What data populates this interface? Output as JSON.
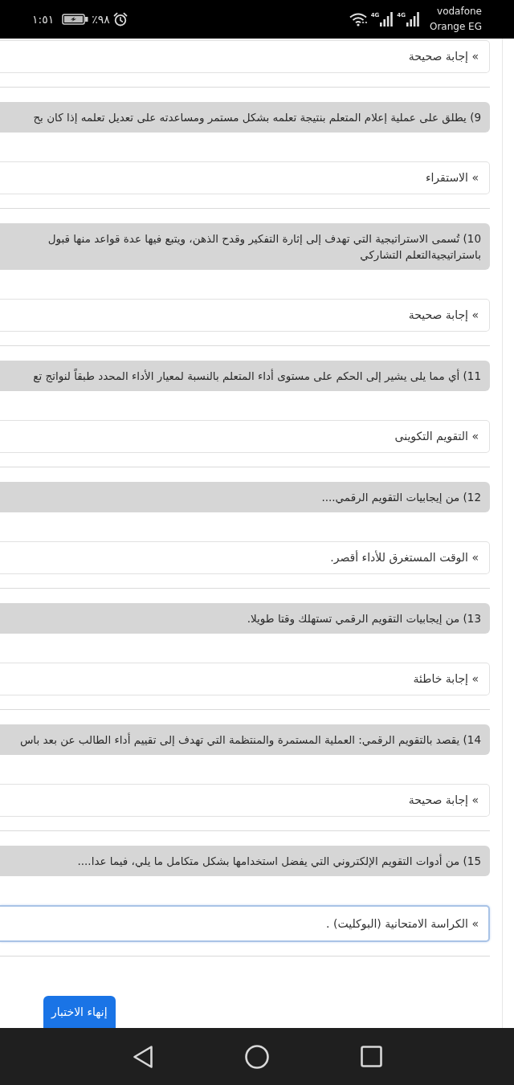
{
  "status_bar": {
    "time": "١:٥١",
    "battery_percent": "٪٩٨",
    "network_types": [
      "4G",
      "4G"
    ],
    "carriers": [
      "vodafone",
      "Orange EG"
    ]
  },
  "quiz": {
    "previous_answer": {
      "text": "» إجابة صحيحة",
      "focused": false
    },
    "questions": [
      {
        "prompt": "9) يطلق على عملية إعلام المتعلم بنتيجة تعلمه بشكل مستمر ومساعدته على تعديل تعلمه إذا كان بح",
        "answer": "» الاستقراء",
        "focused": false
      },
      {
        "prompt": "10) تُسمى الاستراتيجية التي تهدف إلى إثارة التفكير وقدح الذهن، ويتبع فيها عدة قواعد منها قبول باستراتيجيةالتعلم التشاركي",
        "answer": "» إجابة صحيحة",
        "focused": false
      },
      {
        "prompt": "11) أي مما يلى يشير إلى الحكم على مستوى أداء المتعلم بالنسبة لمعيار الأداء المحدد طبقاً لنواتج تع",
        "answer": "» التقويم التكوينى",
        "focused": false
      },
      {
        "prompt": "12) من إيجابيات التقويم الرقمي....",
        "answer": "» الوقت المستغرق للأداء أقصر.",
        "focused": false
      },
      {
        "prompt": "13) من إيجابيات التقويم الرقمي تستهلك وقتا طويلا.",
        "answer": "» إجابة خاطئة",
        "focused": false
      },
      {
        "prompt": "14) يقصد بالتقويم الرقمي: العملية المستمرة والمنتظمة التي تهدف إلى تقييم أداء الطالب عن بعد باس",
        "answer": "» إجابة صحيحة",
        "focused": false
      },
      {
        "prompt": "15) من أدوات التقويم الإلكتروني التي يفضل استخدامها بشكل متكامل ما يلي، فيما عدا....",
        "answer": "» الكراسة الامتحانية (البوكليت) .",
        "focused": true
      }
    ],
    "finish_button": "إنهاء الاختبار"
  }
}
